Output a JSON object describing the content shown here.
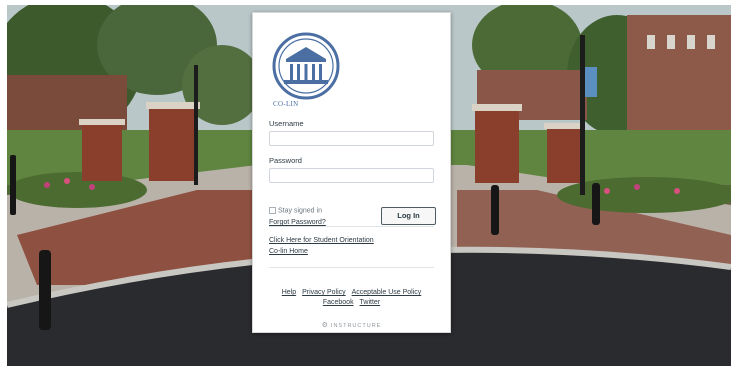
{
  "logo": {
    "text": "CO-LIN",
    "icon": "college-building-icon",
    "color": "#4b6fa3"
  },
  "form": {
    "username_label": "Username",
    "username_value": "",
    "password_label": "Password",
    "password_value": "",
    "stay_signed_in_label": "Stay signed in",
    "stay_signed_in_checked": false,
    "forgot_password": "Forgot Password?",
    "login_button": "Log In"
  },
  "links": {
    "student_orientation": "Click Here for Student Orientation",
    "colin_home": "Co-lin Home"
  },
  "footer": {
    "help": "Help",
    "privacy": "Privacy Policy",
    "acceptable_use": "Acceptable Use Policy",
    "facebook": "Facebook",
    "twitter": "Twitter",
    "brand": "INSTRUCTURE"
  },
  "background": {
    "scene": "campus-plaza-photo"
  }
}
